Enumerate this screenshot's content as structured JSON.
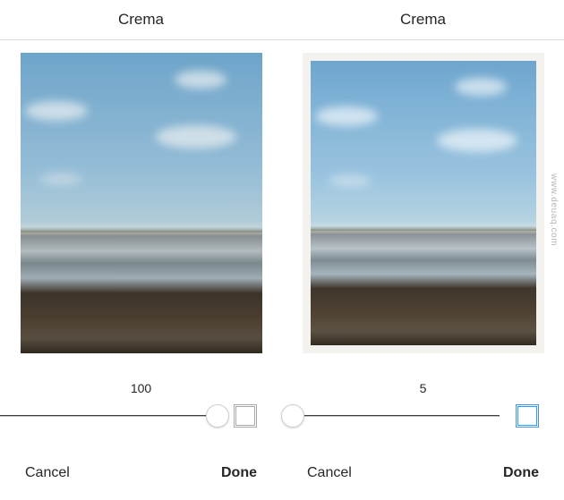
{
  "left": {
    "filter_name": "Crema",
    "slider_value": "100",
    "slider_percent": 100,
    "frame_active": false,
    "cancel_label": "Cancel",
    "done_label": "Done"
  },
  "right": {
    "filter_name": "Crema",
    "slider_value": "5",
    "slider_percent": 5,
    "frame_active": true,
    "cancel_label": "Cancel",
    "done_label": "Done"
  },
  "watermark": "www.deuaq.com"
}
